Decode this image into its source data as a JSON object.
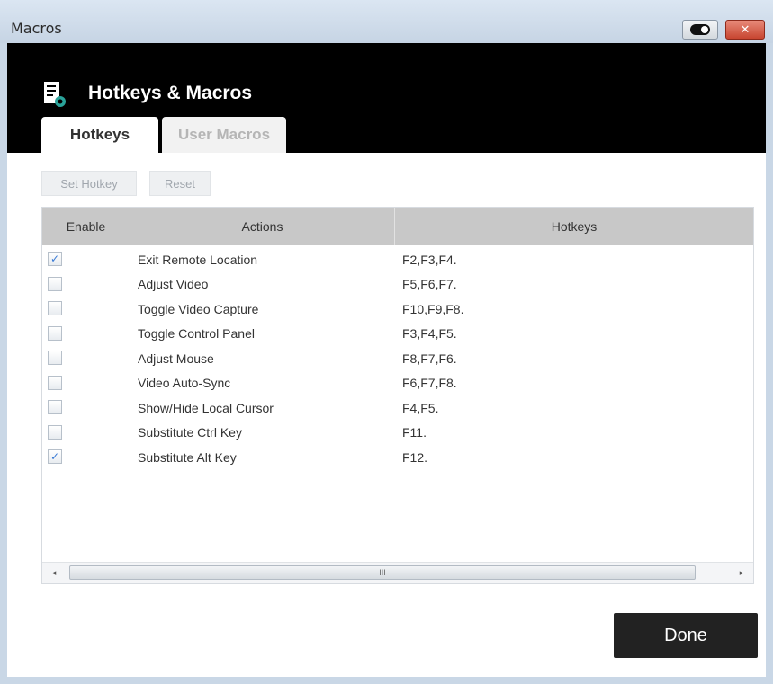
{
  "window": {
    "title": "Macros"
  },
  "header": {
    "title": "Hotkeys & Macros",
    "icon": "hotkeys-macros-icon"
  },
  "tabs": [
    {
      "label": "Hotkeys",
      "active": true
    },
    {
      "label": "User Macros",
      "active": false
    }
  ],
  "toolbar": {
    "set_hotkey_label": "Set Hotkey",
    "reset_label": "Reset"
  },
  "table": {
    "columns": [
      "Enable",
      "Actions",
      "Hotkeys"
    ],
    "rows": [
      {
        "enabled": true,
        "action": "Exit Remote Location",
        "hotkey": "F2,F3,F4."
      },
      {
        "enabled": false,
        "action": "Adjust Video",
        "hotkey": "F5,F6,F7."
      },
      {
        "enabled": false,
        "action": "Toggle Video Capture",
        "hotkey": "F10,F9,F8."
      },
      {
        "enabled": false,
        "action": "Toggle Control Panel",
        "hotkey": "F3,F4,F5."
      },
      {
        "enabled": false,
        "action": "Adjust Mouse",
        "hotkey": "F8,F7,F6."
      },
      {
        "enabled": false,
        "action": "Video Auto-Sync",
        "hotkey": "F6,F7,F8."
      },
      {
        "enabled": false,
        "action": "Show/Hide Local Cursor",
        "hotkey": "F4,F5."
      },
      {
        "enabled": false,
        "action": "Substitute Ctrl Key",
        "hotkey": "F11."
      },
      {
        "enabled": true,
        "action": "Substitute Alt Key",
        "hotkey": "F12."
      }
    ]
  },
  "scrollbar": {
    "thumb_grip": "III",
    "left_arrow": "◂",
    "right_arrow": "▸"
  },
  "footer": {
    "done_label": "Done"
  },
  "colors": {
    "header_bg": "#000000",
    "done_bg": "#222222",
    "check_color": "#3a7bd5"
  }
}
